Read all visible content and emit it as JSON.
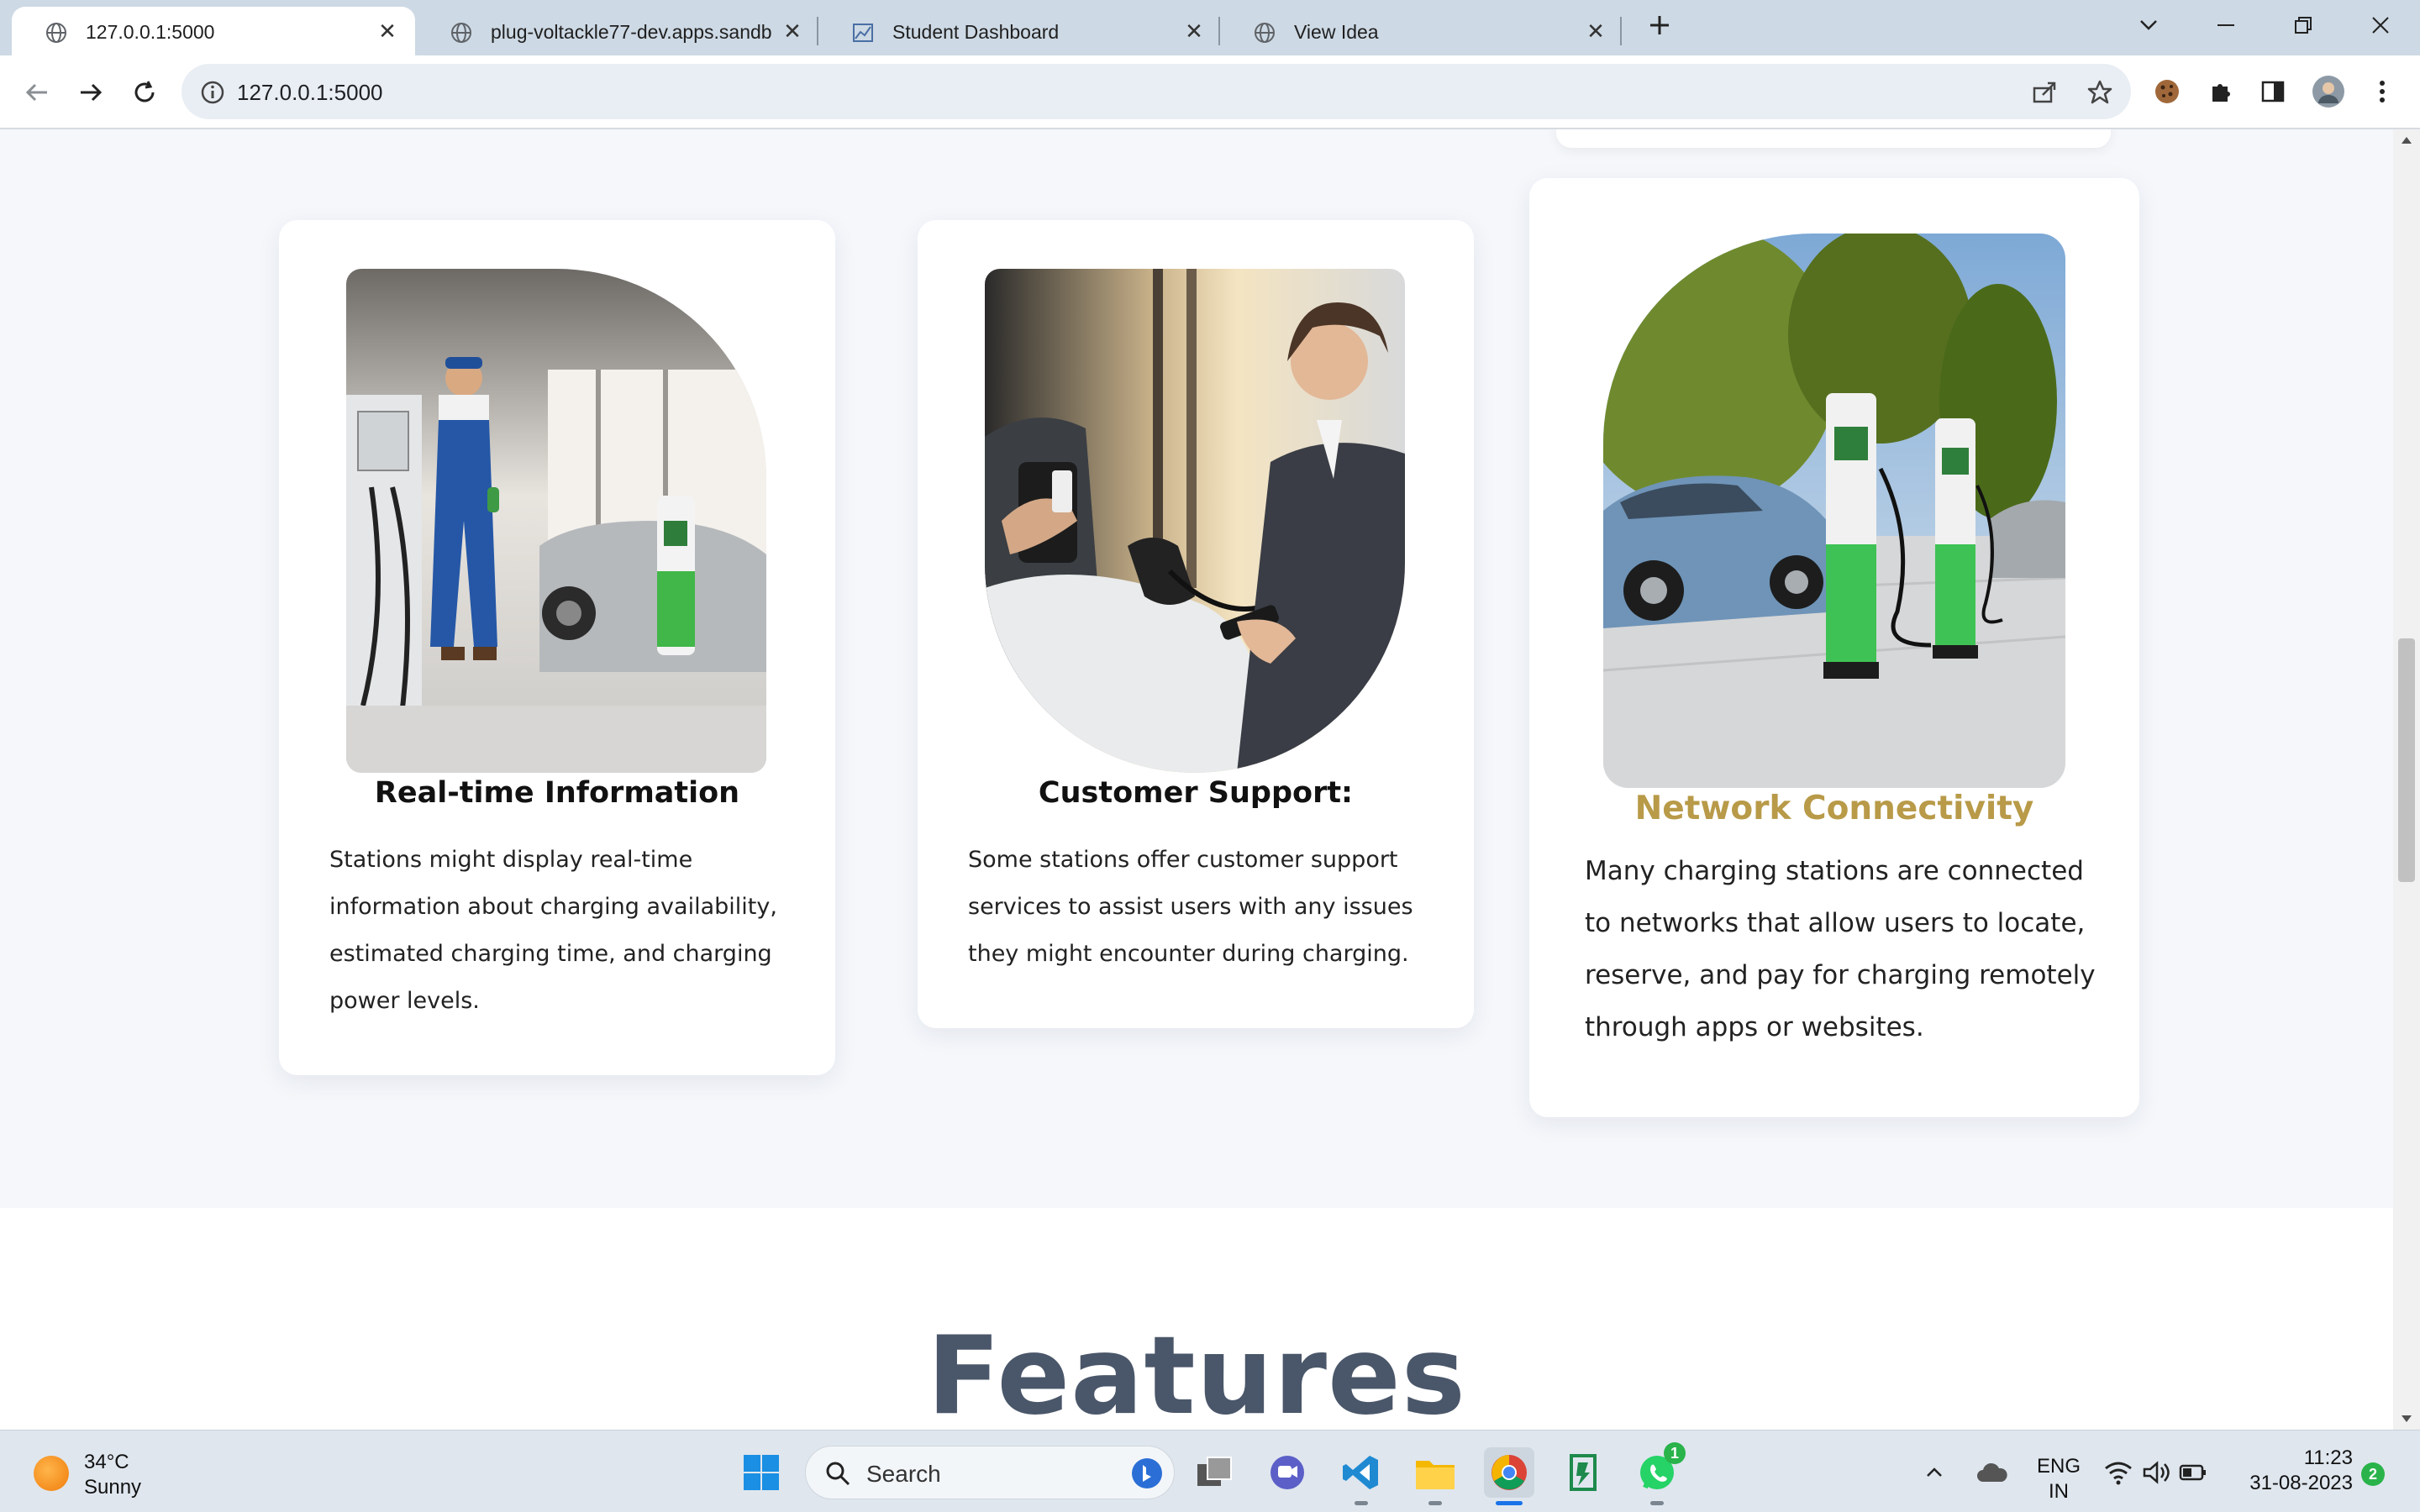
{
  "browser": {
    "tabs": [
      {
        "title": "127.0.0.1:5000",
        "active": true
      },
      {
        "title": "plug-voltackle77-dev.apps.sandb",
        "active": false
      },
      {
        "title": "Student Dashboard",
        "active": false
      },
      {
        "title": "View Idea",
        "active": false
      }
    ],
    "address": "127.0.0.1:5000"
  },
  "cards": [
    {
      "title": "Real-time Information",
      "text": "Stations might display real-time information about charging availability, estimated charging time, and charging power levels.",
      "image_alt": "Technician in overalls standing beside an EV charger and a silver car"
    },
    {
      "title": "Customer Support:",
      "text": "Some stations offer customer support services to assist users with any issues they might encounter during charging.",
      "image_alt": "Smiling support agent handing a phone to a customer at a charging station"
    },
    {
      "title": "Network Connectivity",
      "text": "Many charging stations are connected to networks that allow users to locate, reserve, and pay for charging remotely through apps or websites.",
      "image_alt": "Green EV charging posts with blue electric cars and trees"
    }
  ],
  "features_heading": "Features",
  "colors": {
    "accent_title": "#b89a48",
    "heading": "#4a5669",
    "page_bg": "#f5f7fb"
  },
  "taskbar": {
    "weather_temp": "34°C",
    "weather_condition": "Sunny",
    "search_label": "Search",
    "language_top": "ENG",
    "language_bottom": "IN",
    "time": "11:23",
    "date": "31-08-2023",
    "whatsapp_badge": "1",
    "notification_badge": "2"
  }
}
